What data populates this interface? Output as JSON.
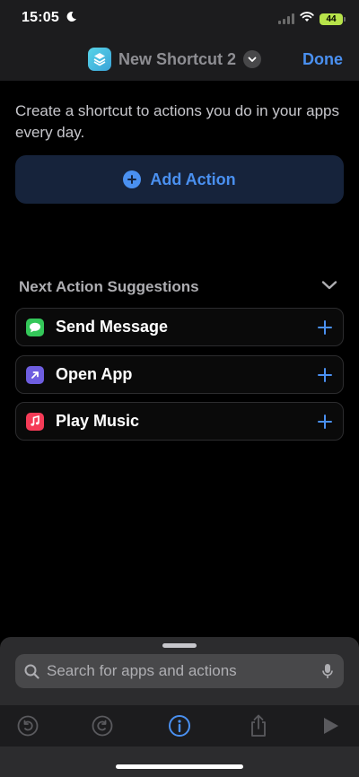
{
  "status_bar": {
    "time": "15:05",
    "battery": "44"
  },
  "nav": {
    "title": "New Shortcut 2",
    "done_label": "Done"
  },
  "main": {
    "intro": "Create a shortcut to actions you do in your apps every day.",
    "add_action_label": "Add Action"
  },
  "suggestions": {
    "title": "Next Action Suggestions",
    "items": [
      {
        "label": "Send Message",
        "icon": "messages-icon",
        "color": "#34c759"
      },
      {
        "label": "Open App",
        "icon": "open-app-icon",
        "color": "#6e5ee0"
      },
      {
        "label": "Play Music",
        "icon": "music-icon",
        "color": "#f53b57"
      }
    ]
  },
  "search": {
    "placeholder": "Search for apps and actions"
  },
  "toolbar": {
    "items": [
      "undo-icon",
      "redo-icon",
      "info-icon",
      "share-icon",
      "play-icon"
    ]
  },
  "colors": {
    "accent": "#4a90f0",
    "background": "#000000",
    "panel": "#1c1c1e"
  }
}
